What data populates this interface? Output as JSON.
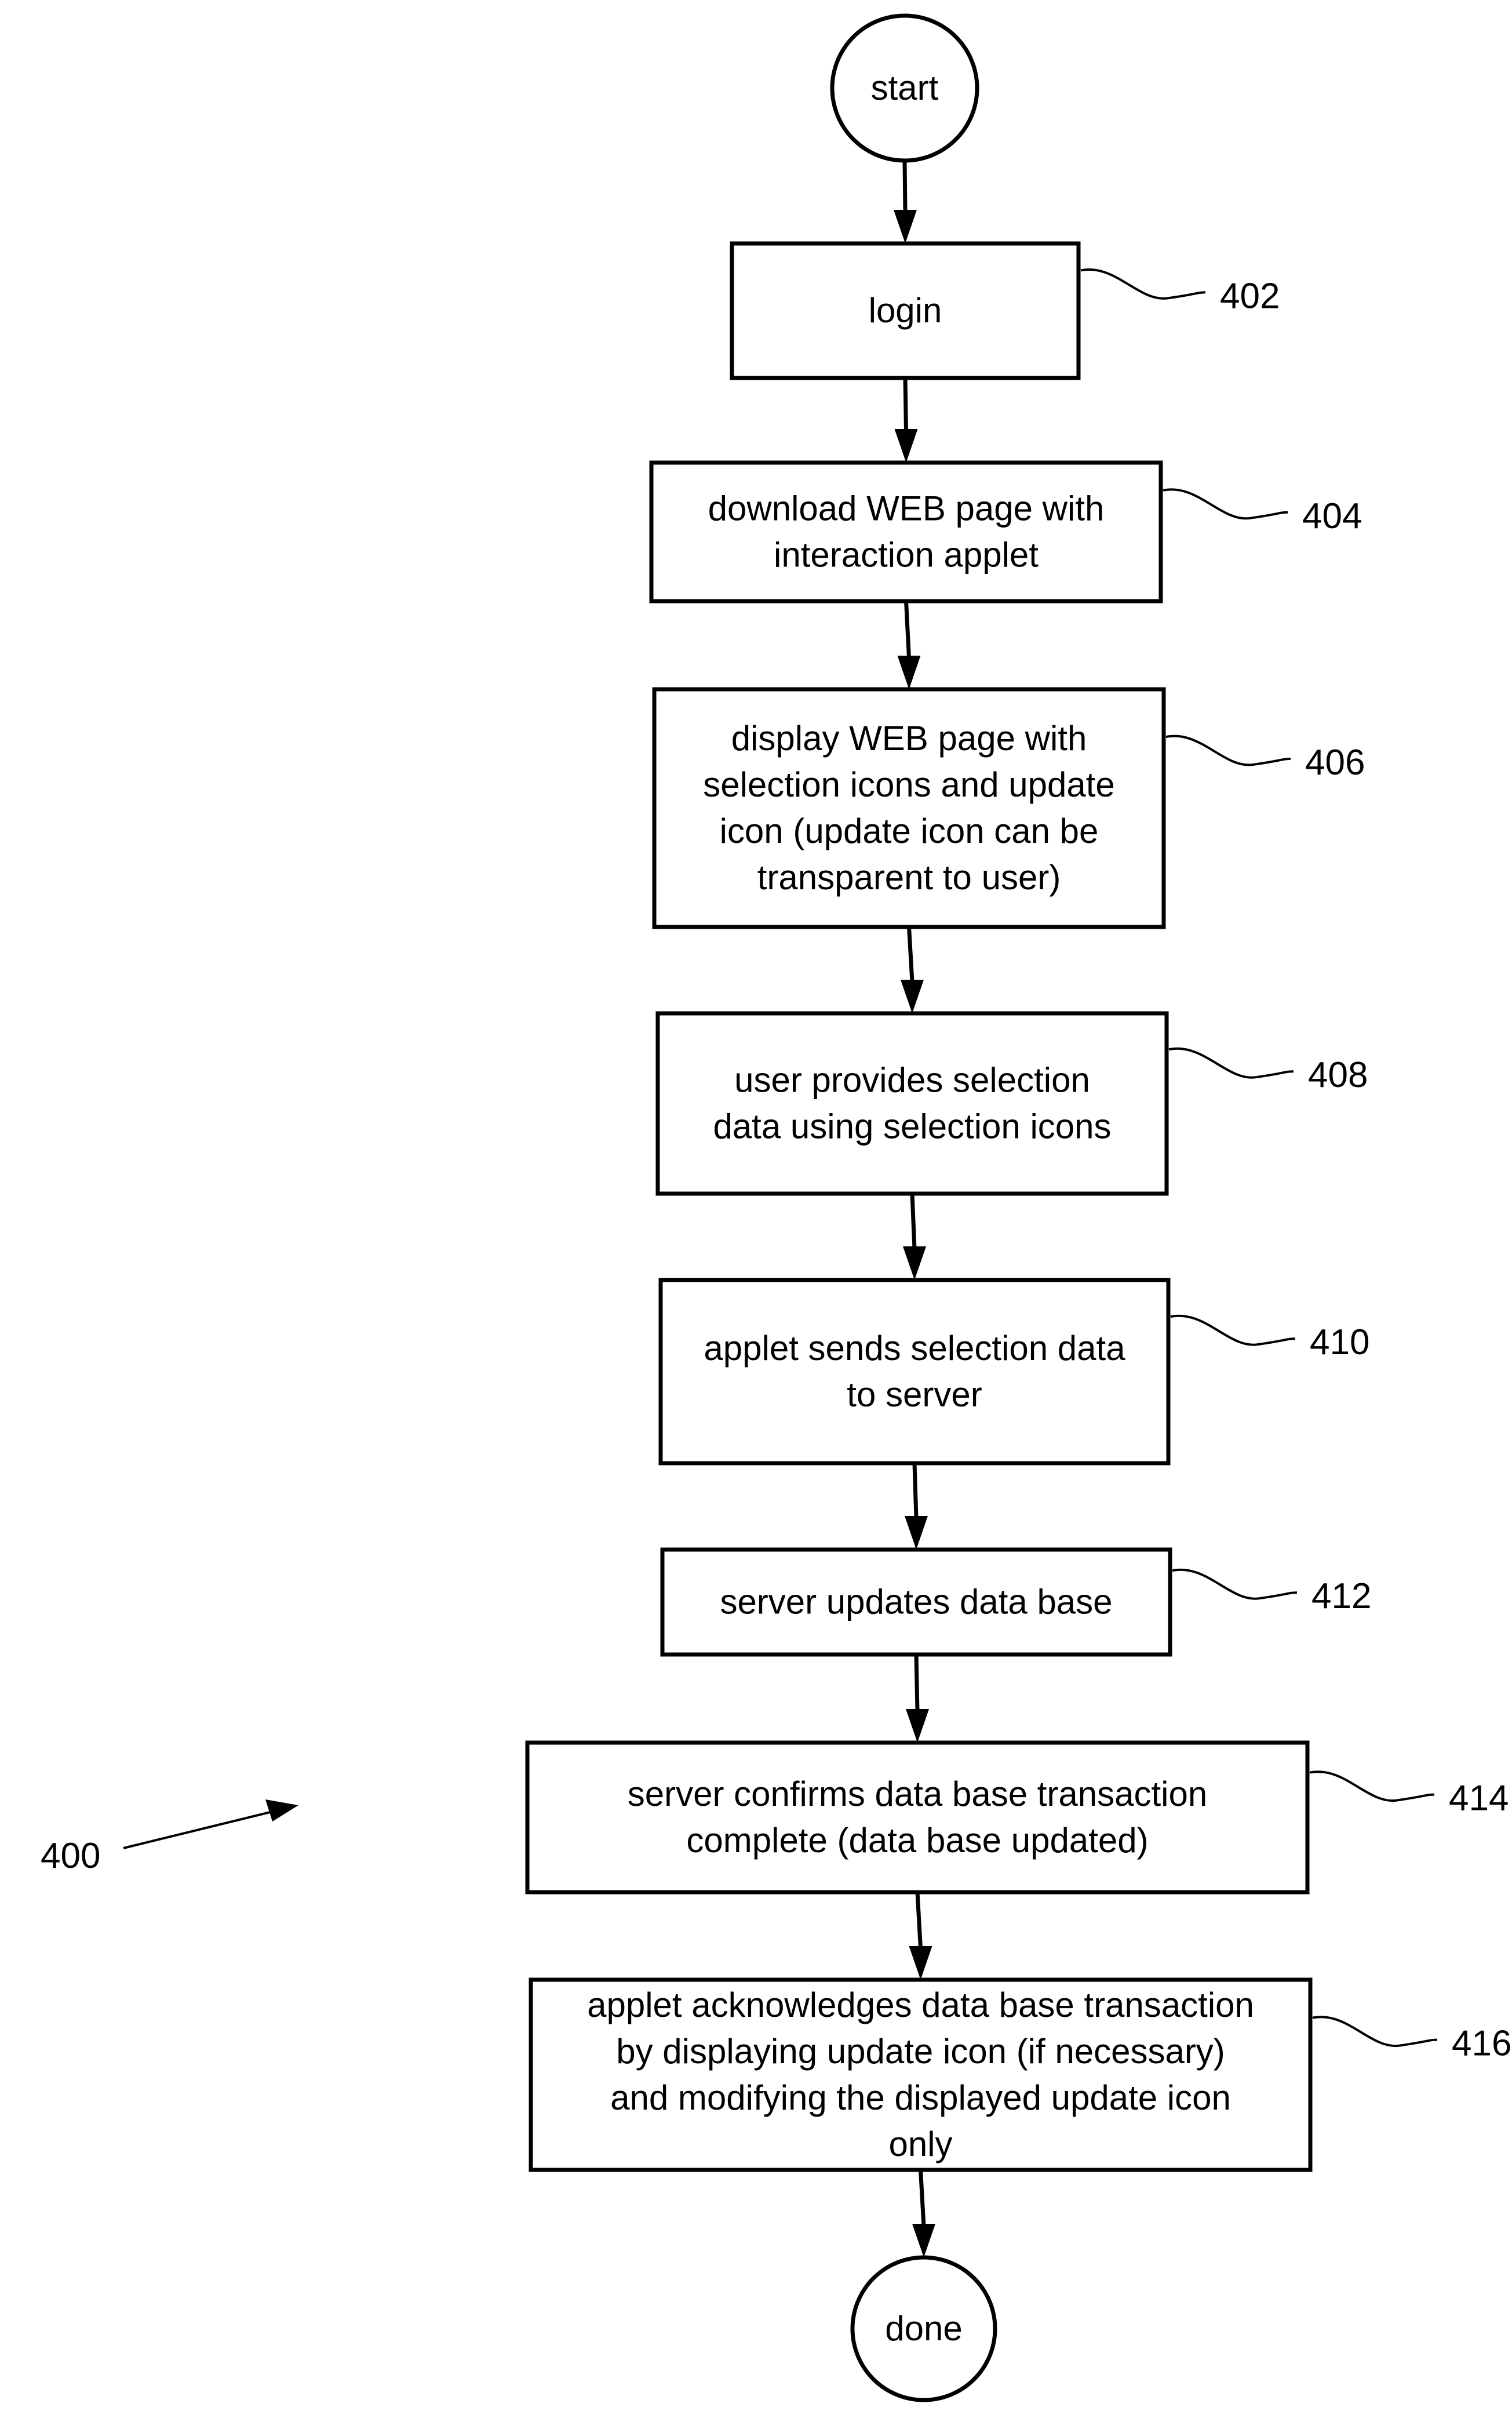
{
  "figure": {
    "reference": "400",
    "nodes": [
      {
        "id": "start",
        "type": "terminal",
        "lines": [
          "start"
        ]
      },
      {
        "id": "402",
        "type": "process",
        "ref": "402",
        "lines": [
          "login"
        ]
      },
      {
        "id": "404",
        "type": "process",
        "ref": "404",
        "lines": [
          "download WEB page with",
          "interaction applet"
        ]
      },
      {
        "id": "406",
        "type": "process",
        "ref": "406",
        "lines": [
          "display WEB page with",
          "selection icons and update",
          "icon (update icon can be",
          "transparent to user)"
        ]
      },
      {
        "id": "408",
        "type": "process",
        "ref": "408",
        "lines": [
          "user provides selection",
          "data using selection icons"
        ]
      },
      {
        "id": "410",
        "type": "process",
        "ref": "410",
        "lines": [
          "applet sends selection data",
          "to server"
        ]
      },
      {
        "id": "412",
        "type": "process",
        "ref": "412",
        "lines": [
          "server updates data base"
        ]
      },
      {
        "id": "414",
        "type": "process",
        "ref": "414",
        "lines": [
          "server confirms data base transaction",
          "complete (data base updated)"
        ]
      },
      {
        "id": "416",
        "type": "process",
        "ref": "416",
        "lines": [
          "applet acknowledges data base transaction",
          "by displaying update icon (if necessary)",
          "and modifying the displayed update icon",
          "only"
        ]
      },
      {
        "id": "done",
        "type": "terminal",
        "lines": [
          "done"
        ]
      }
    ],
    "edges": [
      [
        "start",
        "402"
      ],
      [
        "402",
        "404"
      ],
      [
        "404",
        "406"
      ],
      [
        "406",
        "408"
      ],
      [
        "408",
        "410"
      ],
      [
        "410",
        "412"
      ],
      [
        "412",
        "414"
      ],
      [
        "414",
        "416"
      ],
      [
        "416",
        "done"
      ]
    ]
  }
}
